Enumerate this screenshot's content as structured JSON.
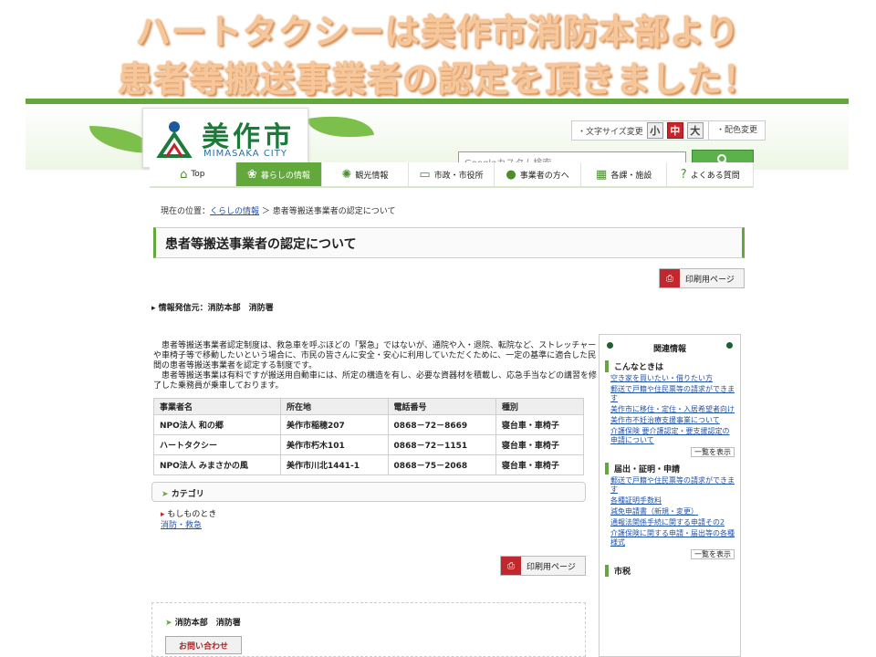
{
  "banner": {
    "line1": "ハートタクシーは美作市消防本部より",
    "line2": "患者等搬送事業者の認定を頂きました！"
  },
  "utility": {
    "fontsize_label": "・文字サイズ変更",
    "fontsize_small": "小",
    "fontsize_medium": "中",
    "fontsize_large": "大",
    "color_label": "・配色変更",
    "search_placeholder": "Googleカスタム検索"
  },
  "logo": {
    "name": "美作市",
    "sub": "MIMASAKA CITY"
  },
  "nav": [
    {
      "label": "Top",
      "icon": "⌂"
    },
    {
      "label": "暮らしの情報",
      "icon": "❀"
    },
    {
      "label": "観光情報",
      "icon": "✺"
    },
    {
      "label": "市政・市役所",
      "icon": "▭"
    },
    {
      "label": "事業者の方へ",
      "icon": "●"
    },
    {
      "label": "各課・施設",
      "icon": "▦"
    },
    {
      "label": "よくある質問",
      "icon": "?"
    }
  ],
  "breadcrumb": {
    "prefix": "現在の位置：",
    "link": "くらしの情報",
    "sep": "＞",
    "current": "患者等搬送事業者の認定について"
  },
  "page_title": "患者等搬送事業者の認定について",
  "print_label": "印刷用ページ",
  "info_source": "情報発信元：消防本部　消防署",
  "intro": [
    "　患者等搬送事業者認定制度は、救急車を呼ぶほどの「緊急」ではないが、通院や入・退院、転院など、ストレッチャーや車椅子等で移動したいという場合に、市民の皆さんに安全・安心に利用していただくために、一定の基準に適合した民間の患者等搬送事業者を認定する制度です。",
    "　患者等搬送事業は有料ですが搬送用自動車には、所定の構造を有し、必要な資器材を積載し、応急手当などの講習を修了した乗務員が乗車しております。"
  ],
  "table": {
    "headers": [
      "事業者名",
      "所在地",
      "電話番号",
      "種別"
    ],
    "rows": [
      [
        "NPO法人 和の郷",
        "美作市稲穂207",
        "0868－72－8669",
        "寝台車・車椅子"
      ],
      [
        "ハートタクシー",
        "美作市朽木101",
        "0868－72－1151",
        "寝台車・車椅子"
      ],
      [
        "NPO法人 みまさかの風",
        "美作市川北1441-1",
        "0868－75－2068",
        "寝台車・車椅子"
      ]
    ]
  },
  "category": {
    "title": "カテゴリ",
    "item": "もしものとき",
    "link": "消防・救急"
  },
  "dept": {
    "title": "消防本部　消防署",
    "contact": "お問い合わせ"
  },
  "side": {
    "title": "関連情報",
    "sections": [
      {
        "title": "こんなときは",
        "links": [
          "空き家を買いたい・借りたい方",
          "郵送で戸籍や住民票等の請求ができます",
          "美作市に移住・定住・入居希望者向け",
          "美作市不妊治療支援事業について",
          "介護保険 要介護認定・要支援認定の申請について"
        ]
      },
      {
        "title": "届出・証明・申請",
        "links": [
          "郵送で戸籍や住民票等の請求ができます",
          "各種証明手数料",
          "減免申請書（新規・変更）",
          "通報法関係手続に関する申請その2",
          "介護保険に関する申請・届出等の各種様式"
        ]
      },
      {
        "title": "市税",
        "links": []
      }
    ],
    "more": "一覧を表示"
  }
}
